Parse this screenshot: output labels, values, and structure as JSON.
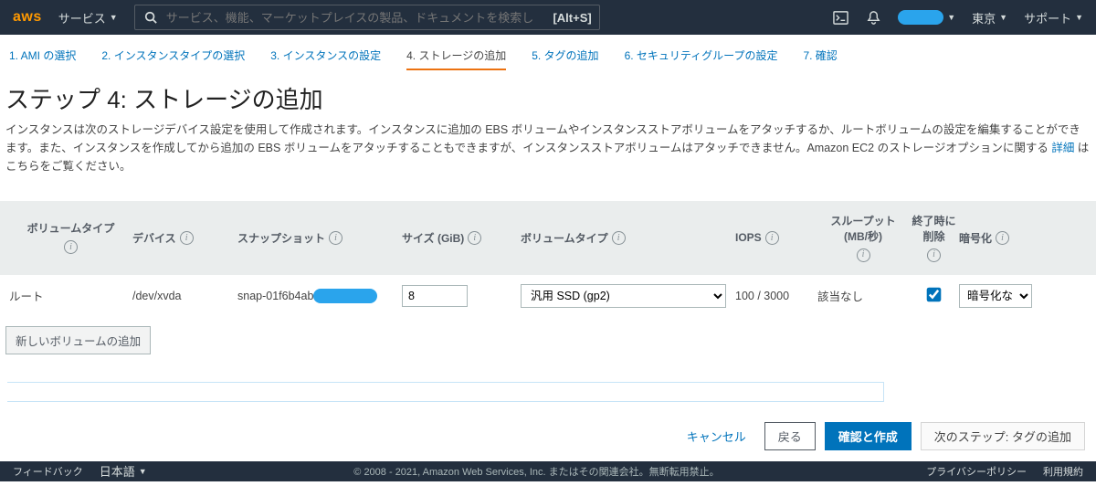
{
  "topnav": {
    "logo": "aws",
    "services": "サービス",
    "search_placeholder": "サービス、機能、マーケットプレイスの製品、ドキュメントを検索し",
    "search_kbd": "[Alt+S]",
    "region": "東京",
    "support": "サポート"
  },
  "wizard": {
    "steps": [
      "1. AMI の選択",
      "2. インスタンスタイプの選択",
      "3. インスタンスの設定",
      "4. ストレージの追加",
      "5. タグの追加",
      "6. セキュリティグループの設定",
      "7. 確認"
    ],
    "active_index": 3
  },
  "page": {
    "heading": "ステップ 4: ストレージの追加",
    "desc_before": "インスタンスは次のストレージデバイス設定を使用して作成されます。インスタンスに追加の EBS ボリュームやインスタンスストアボリュームをアタッチするか、ルートボリュームの設定を編集することができます。また、インスタンスを作成してから追加の EBS ボリュームをアタッチすることもできますが、インスタンスストアボリュームはアタッチできません。Amazon EC2 のストレージオプションに関する ",
    "desc_link": "詳細",
    "desc_after": " はこちらをご覧ください。"
  },
  "table": {
    "headers": {
      "vol_type": "ボリュームタイプ",
      "device": "デバイス",
      "snapshot": "スナップショット",
      "size": "サイズ (GiB)",
      "vol_type2": "ボリュームタイプ",
      "iops": "IOPS",
      "throughput": "スループット (MB/秒)",
      "del_term": "終了時に削除",
      "encrypt": "暗号化"
    },
    "row": {
      "vol_type": "ルート",
      "device": "/dev/xvda",
      "snapshot_prefix": "snap-01f6b4ab",
      "size": "8",
      "vol_type2_selected": "汎用 SSD (gp2)",
      "iops": "100 / 3000",
      "throughput": "該当なし",
      "del_term_checked": true,
      "encrypt_selected": "暗号化な"
    },
    "add_volume": "新しいボリュームの追加"
  },
  "footer": {
    "cancel": "キャンセル",
    "back": "戻る",
    "review": "確認と作成",
    "next": "次のステップ: タグの追加"
  },
  "blackbar": {
    "feedback": "フィードバック",
    "lang": "日本語",
    "copyright": "© 2008 - 2021, Amazon Web Services, Inc. またはその関連会社。無断転用禁止。",
    "privacy": "プライバシーポリシー",
    "terms": "利用規約"
  }
}
